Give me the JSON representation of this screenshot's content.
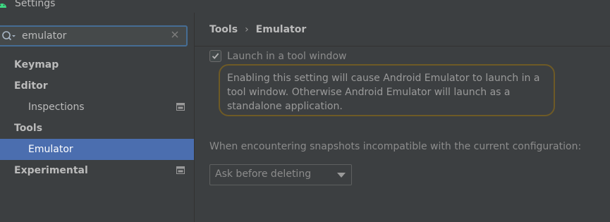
{
  "window": {
    "title": "Settings",
    "icon": "android-icon"
  },
  "search": {
    "value": "emulator",
    "placeholder": ""
  },
  "sidebar": {
    "items": [
      {
        "label": "Keymap",
        "level": 0
      },
      {
        "label": "Editor",
        "level": 0
      },
      {
        "label": "Inspections",
        "level": 1,
        "icon": "project-settings-icon"
      },
      {
        "label": "Tools",
        "level": 0
      },
      {
        "label": "Emulator",
        "level": 1,
        "selected": true
      },
      {
        "label": "Experimental",
        "level": 0,
        "icon": "project-settings-icon"
      }
    ]
  },
  "breadcrumb": {
    "parent": "Tools",
    "separator": "›",
    "current": "Emulator"
  },
  "settings": {
    "launch_checkbox_label": "Launch in a tool window",
    "launch_checked": true,
    "tooltip_text": "Enabling this setting will cause Android Emulator to launch in a tool window. Otherwise Android Emulator will launch as a standalone application.",
    "snapshot_label": "When encountering snapshots incompatible with the current configuration:",
    "snapshot_option": "Ask before deleting"
  },
  "colors": {
    "background": "#3c3f41",
    "selection": "#4b6eaf",
    "search_focus_border": "#466d94",
    "tooltip_border": "#6e5a26"
  }
}
